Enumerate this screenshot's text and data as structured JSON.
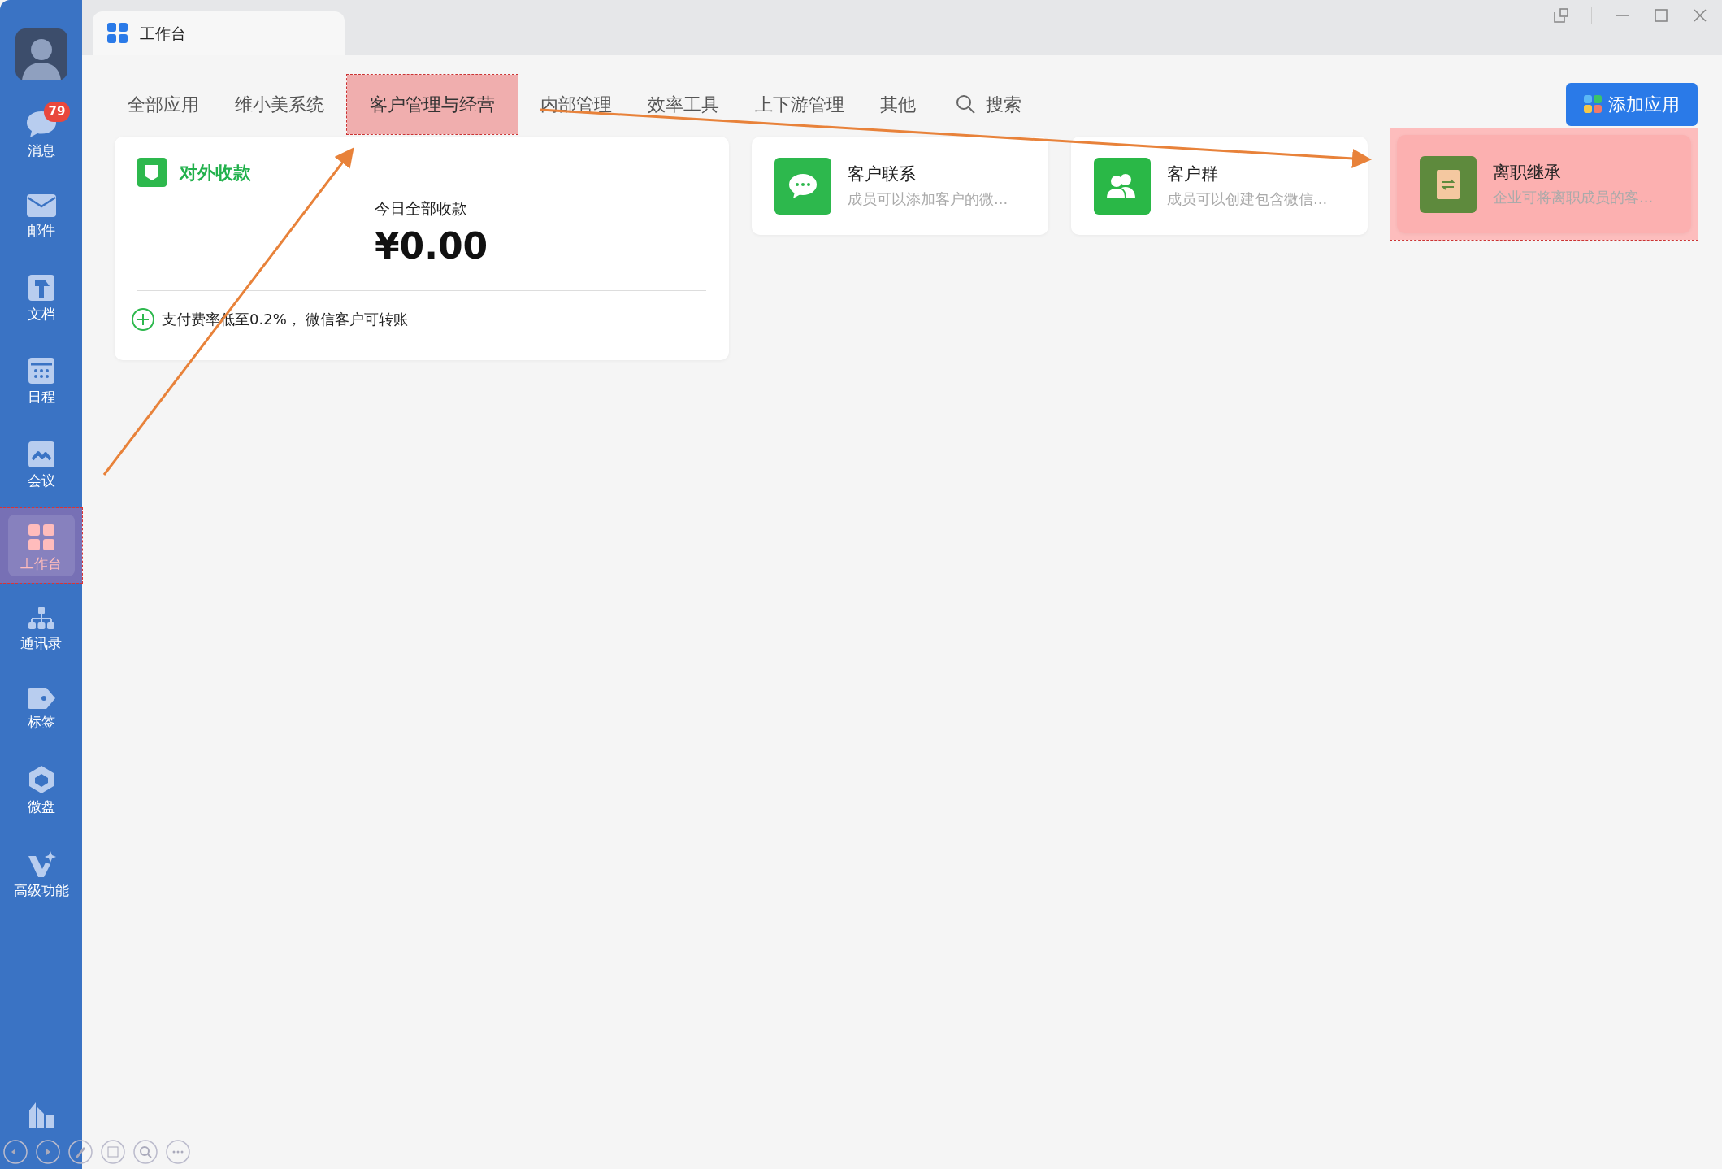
{
  "window": {
    "tab_title": "工作台"
  },
  "sidebar": {
    "items": [
      {
        "label": "消息",
        "kind": "chat",
        "badge": "79",
        "selected": false,
        "highlighted": false
      },
      {
        "label": "邮件",
        "kind": "mail",
        "selected": false,
        "highlighted": false
      },
      {
        "label": "文档",
        "kind": "doc",
        "selected": false,
        "highlighted": false
      },
      {
        "label": "日程",
        "kind": "calendar",
        "selected": false,
        "highlighted": false
      },
      {
        "label": "会议",
        "kind": "meeting",
        "selected": false,
        "highlighted": false
      },
      {
        "label": "工作台",
        "kind": "grid",
        "selected": true,
        "highlighted": true
      },
      {
        "label": "通讯录",
        "kind": "org",
        "selected": false,
        "highlighted": false
      },
      {
        "label": "标签",
        "kind": "tag",
        "selected": false,
        "highlighted": false
      },
      {
        "label": "微盘",
        "kind": "disk",
        "selected": false,
        "highlighted": false
      },
      {
        "label": "高级功能",
        "kind": "sparkle",
        "selected": false,
        "highlighted": false
      }
    ]
  },
  "categories": [
    {
      "label": "全部应用",
      "highlighted": false
    },
    {
      "label": "维小美系统",
      "highlighted": false
    },
    {
      "label": "客户管理与经营",
      "highlighted": true
    },
    {
      "label": "内部管理",
      "highlighted": false
    },
    {
      "label": "效率工具",
      "highlighted": false
    },
    {
      "label": "上下游管理",
      "highlighted": false
    },
    {
      "label": "其他",
      "highlighted": false
    }
  ],
  "search": {
    "label": "搜索"
  },
  "add_button": {
    "label": "添加应用"
  },
  "payment_card": {
    "title": "对外收款",
    "caption": "今日全部收款",
    "amount": "¥0.00",
    "footer": "支付费率低至0.2%， 微信客户可转账"
  },
  "apps": [
    {
      "name": "客户联系",
      "description": "成员可以添加客户的微...",
      "kind": "chat",
      "highlighted": false
    },
    {
      "name": "客户群",
      "description": "成员可以创建包含微信...",
      "kind": "group",
      "highlighted": false
    },
    {
      "name": "离职继承",
      "description": "企业可将离职成员的客...",
      "kind": "transfer",
      "highlighted": true
    }
  ]
}
